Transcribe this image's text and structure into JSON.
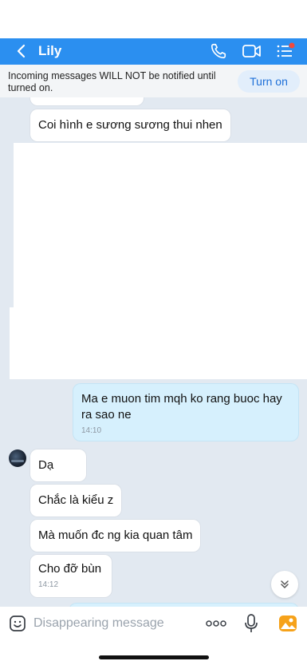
{
  "header": {
    "title": "Lily",
    "back_icon": "chevron-left-icon",
    "call_icon": "phone-icon",
    "video_icon": "video-icon",
    "menu_icon": "list-menu-icon",
    "accent": "#2b8ff0",
    "badge_color": "#f04a3e"
  },
  "notice": {
    "text": "Incoming messages WILL NOT be notified until turned on.",
    "button_label": "Turn on"
  },
  "messages": [
    {
      "dir": "in",
      "text": "Coi hình e sương sương thui nhen",
      "time": ""
    },
    {
      "dir": "out",
      "text": "Ma e muon tim mqh ko rang buoc hay ra sao ne",
      "time": "14:10"
    },
    {
      "dir": "in",
      "text": "Dạ",
      "time": ""
    },
    {
      "dir": "in",
      "text": "Chắc là kiểu z",
      "time": ""
    },
    {
      "dir": "in",
      "text": "Mà muốn đc ng kia quan tâm",
      "time": ""
    },
    {
      "dir": "in",
      "text": "Cho đỡ bùn",
      "time": "14:12"
    }
  ],
  "composer": {
    "placeholder": "Disappearing message",
    "sticker_icon": "emoji-sticker-icon",
    "more_icon": "more-dots-icon",
    "mic_icon": "microphone-icon",
    "image_icon": "image-gallery-icon"
  },
  "scroll_icon": "double-chevron-down-icon"
}
